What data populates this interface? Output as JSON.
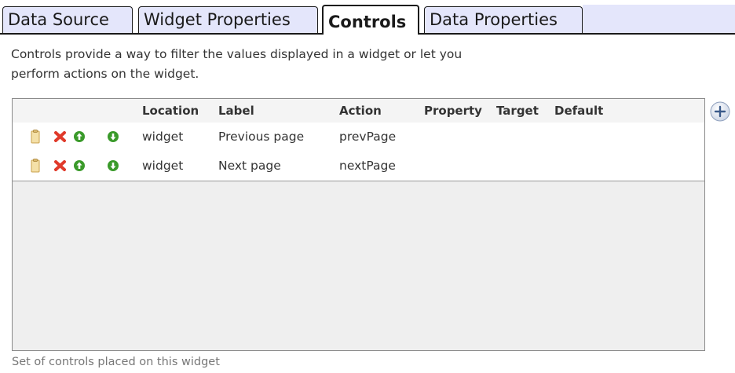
{
  "tabs": [
    {
      "label": "Data Source",
      "active": false
    },
    {
      "label": "Widget Properties",
      "active": false
    },
    {
      "label": "Controls",
      "active": true
    },
    {
      "label": "Data Properties",
      "active": false
    }
  ],
  "description": {
    "line1": "Controls provide a way to filter the values displayed in a widget or let you",
    "line2": "perform actions on the widget."
  },
  "table": {
    "columns": [
      "Location",
      "Label",
      "Action",
      "Property",
      "Target",
      "Default"
    ],
    "rows": [
      {
        "location": "widget",
        "label": "Previous page",
        "action": "prevPage",
        "property": "",
        "target": "",
        "default": ""
      },
      {
        "location": "widget",
        "label": "Next page",
        "action": "nextPage",
        "property": "",
        "target": "",
        "default": ""
      }
    ],
    "row_icons": [
      "clipboard-icon",
      "delete-icon",
      "move-up-icon",
      "move-down-icon"
    ]
  },
  "add_button": {
    "icon": "plus-icon"
  },
  "footer_note": "Set of controls placed on this widget",
  "colors": {
    "tab_bg": "#e4e6fb",
    "delete_red": "#e03a2a",
    "arrow_green": "#3a9a2a",
    "clipboard_yellow": "#e8c873"
  }
}
